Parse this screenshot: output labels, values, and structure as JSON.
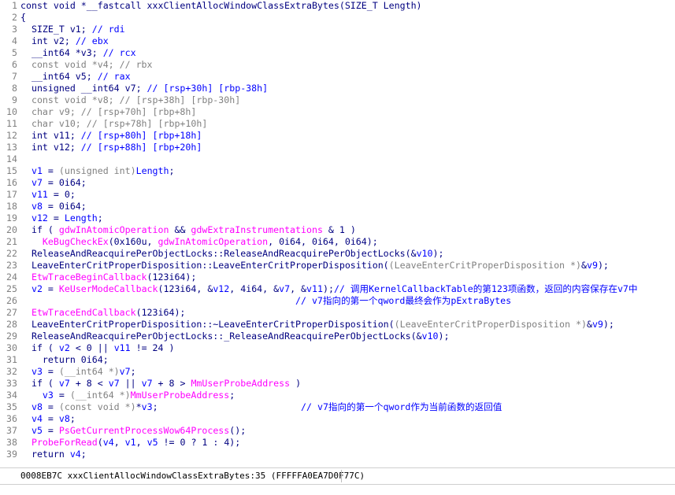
{
  "editor": {
    "lines": [
      {
        "n": "1",
        "segs": [
          [
            "k",
            "const void *__fastcall xxxClientAllocWindowClassExtraBytes(SIZE_T Length)"
          ]
        ]
      },
      {
        "n": "2",
        "segs": [
          [
            "k",
            "{"
          ]
        ]
      },
      {
        "n": "3",
        "segs": [
          [
            "k",
            "  SIZE_T v1; "
          ],
          [
            "c",
            "// rdi"
          ]
        ]
      },
      {
        "n": "4",
        "segs": [
          [
            "k",
            "  int v2; "
          ],
          [
            "c",
            "// ebx"
          ]
        ]
      },
      {
        "n": "5",
        "segs": [
          [
            "k",
            "  __int64 *v3; "
          ],
          [
            "c",
            "// rcx"
          ]
        ]
      },
      {
        "n": "6",
        "segs": [
          [
            "t",
            "  const void *v4; // rbx"
          ]
        ]
      },
      {
        "n": "7",
        "segs": [
          [
            "k",
            "  __int64 v5; "
          ],
          [
            "c",
            "// rax"
          ]
        ]
      },
      {
        "n": "8",
        "segs": [
          [
            "k",
            "  unsigned __int64 v7; "
          ],
          [
            "c",
            "// [rsp+30h] [rbp-38h]"
          ]
        ]
      },
      {
        "n": "9",
        "segs": [
          [
            "t",
            "  const void *v8; // [rsp+38h] [rbp-30h]"
          ]
        ]
      },
      {
        "n": "10",
        "segs": [
          [
            "t",
            "  char v9; // [rsp+70h] [rbp+8h]"
          ]
        ]
      },
      {
        "n": "11",
        "segs": [
          [
            "t",
            "  char v10; // [rsp+78h] [rbp+10h]"
          ]
        ]
      },
      {
        "n": "12",
        "segs": [
          [
            "k",
            "  int v11; "
          ],
          [
            "c",
            "// [rsp+80h] [rbp+18h]"
          ]
        ]
      },
      {
        "n": "13",
        "segs": [
          [
            "k",
            "  int v12; "
          ],
          [
            "c",
            "// [rsp+88h] [rbp+20h]"
          ]
        ]
      },
      {
        "n": "14",
        "segs": []
      },
      {
        "n": "15",
        "segs": [
          [
            "v",
            "  v1"
          ],
          [
            "k",
            " = "
          ],
          [
            "t",
            "(unsigned int)"
          ],
          [
            "v",
            "Length"
          ],
          [
            "k",
            ";"
          ]
        ]
      },
      {
        "n": "16",
        "segs": [
          [
            "v",
            "  v7"
          ],
          [
            "k",
            " = 0i64;"
          ]
        ]
      },
      {
        "n": "17",
        "segs": [
          [
            "v",
            "  v11"
          ],
          [
            "k",
            " = 0;"
          ]
        ]
      },
      {
        "n": "18",
        "segs": [
          [
            "v",
            "  v8"
          ],
          [
            "k",
            " = 0i64;"
          ]
        ]
      },
      {
        "n": "19",
        "segs": [
          [
            "v",
            "  v12"
          ],
          [
            "k",
            " = "
          ],
          [
            "v",
            "Length"
          ],
          [
            "k",
            ";"
          ]
        ]
      },
      {
        "n": "20",
        "segs": [
          [
            "k",
            "  if ( "
          ],
          [
            "g",
            "gdwInAtomicOperation"
          ],
          [
            "k",
            " && "
          ],
          [
            "g",
            "gdwExtraInstrumentations"
          ],
          [
            "k",
            " & 1 )"
          ]
        ]
      },
      {
        "n": "21",
        "segs": [
          [
            "k",
            "    "
          ],
          [
            "f",
            "KeBugCheckEx"
          ],
          [
            "k",
            "(0x160u, "
          ],
          [
            "g",
            "gdwInAtomicOperation"
          ],
          [
            "k",
            ", 0i64, 0i64, 0i64);"
          ]
        ]
      },
      {
        "n": "22",
        "segs": [
          [
            "k",
            "  ReleaseAndReacquirePerObjectLocks::ReleaseAndReacquirePerObjectLocks(&"
          ],
          [
            "v",
            "v10"
          ],
          [
            "k",
            ");"
          ]
        ]
      },
      {
        "n": "23",
        "segs": [
          [
            "k",
            "  LeaveEnterCritProperDisposition::LeaveEnterCritProperDisposition("
          ],
          [
            "t",
            "(LeaveEnterCritProperDisposition *)"
          ],
          [
            "k",
            "&"
          ],
          [
            "v",
            "v9"
          ],
          [
            "k",
            ");"
          ]
        ]
      },
      {
        "n": "24",
        "segs": [
          [
            "f",
            "  EtwTraceBeginCallback"
          ],
          [
            "k",
            "(123i64);"
          ]
        ]
      },
      {
        "n": "25",
        "segs": [
          [
            "v",
            "  v2"
          ],
          [
            "k",
            " = "
          ],
          [
            "f",
            "KeUserModeCallback"
          ],
          [
            "k",
            "(123i64, &"
          ],
          [
            "v",
            "v12"
          ],
          [
            "k",
            ", 4i64, &"
          ],
          [
            "v",
            "v7"
          ],
          [
            "k",
            ", &"
          ],
          [
            "v",
            "v11"
          ],
          [
            "k",
            ");"
          ],
          [
            "cm",
            "// 调用KernelCallbackTable的第123项函数，返回的内容保存在v7中"
          ]
        ]
      },
      {
        "n": "26",
        "segs": [
          [
            "cm",
            "                                                  // v7指向的第一个qword最终会作为pExtraBytes"
          ]
        ]
      },
      {
        "n": "27",
        "segs": [
          [
            "f",
            "  EtwTraceEndCallback"
          ],
          [
            "k",
            "(123i64);"
          ]
        ]
      },
      {
        "n": "28",
        "segs": [
          [
            "k",
            "  LeaveEnterCritProperDisposition::~LeaveEnterCritProperDisposition("
          ],
          [
            "t",
            "(LeaveEnterCritProperDisposition *)"
          ],
          [
            "k",
            "&"
          ],
          [
            "v",
            "v9"
          ],
          [
            "k",
            ");"
          ]
        ]
      },
      {
        "n": "29",
        "segs": [
          [
            "k",
            "  ReleaseAndReacquirePerObjectLocks::_ReleaseAndReacquirePerObjectLocks(&"
          ],
          [
            "v",
            "v10"
          ],
          [
            "k",
            ");"
          ]
        ]
      },
      {
        "n": "30",
        "segs": [
          [
            "k",
            "  if ( "
          ],
          [
            "v",
            "v2"
          ],
          [
            "k",
            " < 0 || "
          ],
          [
            "v",
            "v11"
          ],
          [
            "k",
            " != 24 )"
          ]
        ]
      },
      {
        "n": "31",
        "segs": [
          [
            "k",
            "    return 0i64;"
          ]
        ]
      },
      {
        "n": "32",
        "segs": [
          [
            "v",
            "  v3"
          ],
          [
            "k",
            " = "
          ],
          [
            "t",
            "(__int64 *)"
          ],
          [
            "v",
            "v7"
          ],
          [
            "k",
            ";"
          ]
        ]
      },
      {
        "n": "33",
        "segs": [
          [
            "k",
            "  if ( "
          ],
          [
            "v",
            "v7"
          ],
          [
            "k",
            " + 8 < "
          ],
          [
            "v",
            "v7"
          ],
          [
            "k",
            " || "
          ],
          [
            "v",
            "v7"
          ],
          [
            "k",
            " + 8 > "
          ],
          [
            "g",
            "MmUserProbeAddress"
          ],
          [
            "k",
            " )"
          ]
        ]
      },
      {
        "n": "34",
        "segs": [
          [
            "v",
            "    v3"
          ],
          [
            "k",
            " = "
          ],
          [
            "t",
            "(__int64 *)"
          ],
          [
            "g",
            "MmUserProbeAddress"
          ],
          [
            "k",
            ";"
          ]
        ]
      },
      {
        "n": "35",
        "segs": [
          [
            "v",
            "  v8"
          ],
          [
            "k",
            " = "
          ],
          [
            "t",
            "(const void *)"
          ],
          [
            "k",
            "*"
          ],
          [
            "v",
            "v3"
          ],
          [
            "k",
            ";"
          ],
          [
            "cm",
            "                          // v7指向的第一个qword作为当前函数的返回值"
          ]
        ]
      },
      {
        "n": "36",
        "segs": [
          [
            "v",
            "  v4"
          ],
          [
            "k",
            " = "
          ],
          [
            "v",
            "v8"
          ],
          [
            "k",
            ";"
          ]
        ]
      },
      {
        "n": "37",
        "segs": [
          [
            "v",
            "  v5"
          ],
          [
            "k",
            " = "
          ],
          [
            "f",
            "PsGetCurrentProcessWow64Process"
          ],
          [
            "k",
            "();"
          ]
        ]
      },
      {
        "n": "38",
        "segs": [
          [
            "f",
            "  ProbeForRead"
          ],
          [
            "k",
            "("
          ],
          [
            "v",
            "v4"
          ],
          [
            "k",
            ", "
          ],
          [
            "v",
            "v1"
          ],
          [
            "k",
            ", "
          ],
          [
            "v",
            "v5"
          ],
          [
            "k",
            " != 0 ? 1 : 4);"
          ]
        ]
      },
      {
        "n": "39",
        "segs": [
          [
            "k",
            "  return "
          ],
          [
            "v",
            "v4"
          ],
          [
            "k",
            ";"
          ]
        ]
      }
    ]
  },
  "statusbar": {
    "text": "0008EB7C xxxClientAllocWindowClassExtraBytes:35 (FFFFFA0EA7D0F77C)"
  }
}
